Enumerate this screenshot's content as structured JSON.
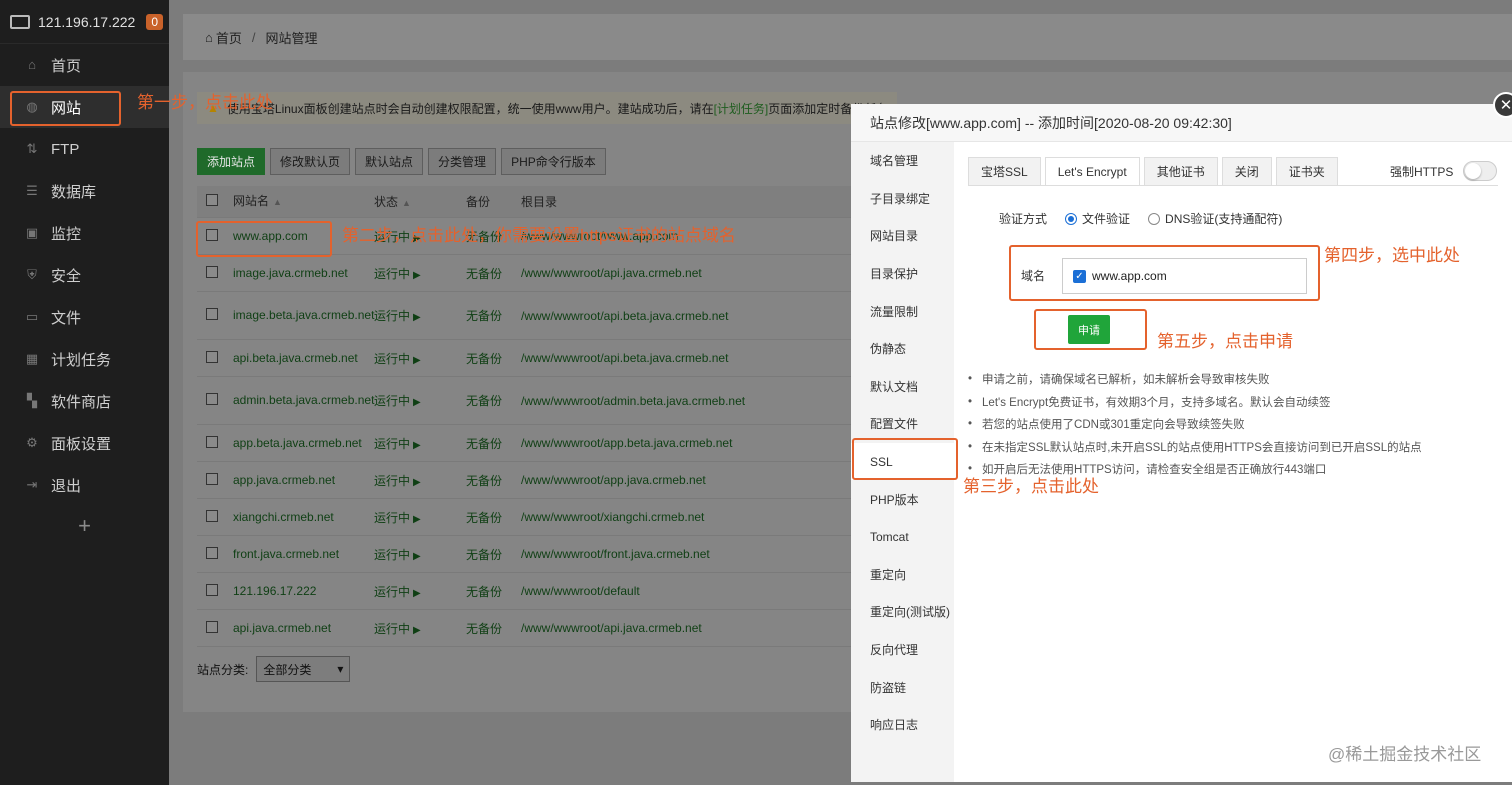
{
  "sidebar": {
    "server_ip": "121.196.17.222",
    "badge": "0",
    "items": [
      {
        "label": "首页",
        "icon": "home-icon",
        "glyph": "⌂"
      },
      {
        "label": "网站",
        "icon": "globe-icon",
        "glyph": "◍"
      },
      {
        "label": "FTP",
        "icon": "ftp-icon",
        "glyph": "⇅"
      },
      {
        "label": "数据库",
        "icon": "database-icon",
        "glyph": "☰"
      },
      {
        "label": "监控",
        "icon": "monitor-icon",
        "glyph": "▣"
      },
      {
        "label": "安全",
        "icon": "shield-icon",
        "glyph": "⛨"
      },
      {
        "label": "文件",
        "icon": "folder-icon",
        "glyph": "▭"
      },
      {
        "label": "计划任务",
        "icon": "calendar-icon",
        "glyph": "▦"
      },
      {
        "label": "软件商店",
        "icon": "apps-icon",
        "glyph": "▚"
      },
      {
        "label": "面板设置",
        "icon": "gear-icon",
        "glyph": "⚙"
      },
      {
        "label": "退出",
        "icon": "logout-icon",
        "glyph": "⇥"
      }
    ],
    "add": "+"
  },
  "breadcrumb": {
    "home": "首页",
    "sep": "/",
    "current": "网站管理"
  },
  "notice": {
    "pre": "使用宝塔Linux面板创建站点时会自动创建权限配置，统一使用www用户。建站成功后，请在",
    "link": "[计划任务]",
    "post": "页面添加定时备份任务"
  },
  "toolbar": {
    "add_site": "添加站点",
    "edit_default_page": "修改默认页",
    "default_site": "默认站点",
    "category_manage": "分类管理",
    "php_cli": "PHP命令行版本"
  },
  "table": {
    "headers": {
      "name": "网站名",
      "status": "状态",
      "backup": "备份",
      "root": "根目录"
    },
    "rows": [
      {
        "name": "www.app.com",
        "status": "运行中",
        "backup": "无备份",
        "root": "/www/wwwroot/www.app.com"
      },
      {
        "name": "image.java.crmeb.net",
        "status": "运行中",
        "backup": "无备份",
        "root": "/www/wwwroot/api.java.crmeb.net"
      },
      {
        "name": "image.beta.java.crmeb.net",
        "status": "运行中",
        "backup": "无备份",
        "root": "/www/wwwroot/api.beta.java.crmeb.net"
      },
      {
        "name": "api.beta.java.crmeb.net",
        "status": "运行中",
        "backup": "无备份",
        "root": "/www/wwwroot/api.beta.java.crmeb.net"
      },
      {
        "name": "admin.beta.java.crmeb.net",
        "status": "运行中",
        "backup": "无备份",
        "root": "/www/wwwroot/admin.beta.java.crmeb.net"
      },
      {
        "name": "app.beta.java.crmeb.net",
        "status": "运行中",
        "backup": "无备份",
        "root": "/www/wwwroot/app.beta.java.crmeb.net"
      },
      {
        "name": "app.java.crmeb.net",
        "status": "运行中",
        "backup": "无备份",
        "root": "/www/wwwroot/app.java.crmeb.net"
      },
      {
        "name": "xiangchi.crmeb.net",
        "status": "运行中",
        "backup": "无备份",
        "root": "/www/wwwroot/xiangchi.crmeb.net"
      },
      {
        "name": "front.java.crmeb.net",
        "status": "运行中",
        "backup": "无备份",
        "root": "/www/wwwroot/front.java.crmeb.net"
      },
      {
        "name": "121.196.17.222",
        "status": "运行中",
        "backup": "无备份",
        "root": "/www/wwwroot/default"
      },
      {
        "name": "api.java.crmeb.net",
        "status": "运行中",
        "backup": "无备份",
        "root": "/www/wwwroot/api.java.crmeb.net"
      }
    ],
    "footer_label": "站点分类:",
    "category_selected": "全部分类"
  },
  "modal": {
    "title": "站点修改[www.app.com] -- 添加时间[2020-08-20 09:42:30]",
    "nav": [
      "域名管理",
      "子目录绑定",
      "网站目录",
      "目录保护",
      "流量限制",
      "伪静态",
      "默认文档",
      "配置文件",
      "SSL",
      "PHP版本",
      "Tomcat",
      "重定向",
      "重定向(测试版)",
      "反向代理",
      "防盗链",
      "响应日志"
    ],
    "tabs": [
      "宝塔SSL",
      "Let's Encrypt",
      "其他证书",
      "关闭",
      "证书夹"
    ],
    "force_https": "强制HTTPS",
    "verify_label": "验证方式",
    "verify_file": "文件验证",
    "verify_dns": "DNS验证(支持通配符)",
    "domain_label": "域名",
    "domain_value": "www.app.com",
    "apply": "申请",
    "tips": [
      "申请之前，请确保域名已解析，如未解析会导致审核失败",
      "Let's Encrypt免费证书，有效期3个月，支持多域名。默认会自动续签",
      "若您的站点使用了CDN或301重定向会导致续签失败",
      "在未指定SSL默认站点时,未开启SSL的站点使用HTTPS会直接访问到已开启SSL的站点",
      "如开启后无法使用HTTPS访问，请检查安全组是否正确放行443端口"
    ]
  },
  "annotations": {
    "step1": "第一步，点击此处",
    "step2": "第二步，点击此处，你需要设置https证书的站点域名",
    "step3": "第三步，点击此处",
    "step4": "第四步，选中此处",
    "step5": "第五步，点击申请"
  },
  "watermark": "@稀土掘金技术社区",
  "colors": {
    "accent_green": "#20a53a",
    "annotation": "#e4622d",
    "sidebar_bg": "#1e1e1e"
  }
}
